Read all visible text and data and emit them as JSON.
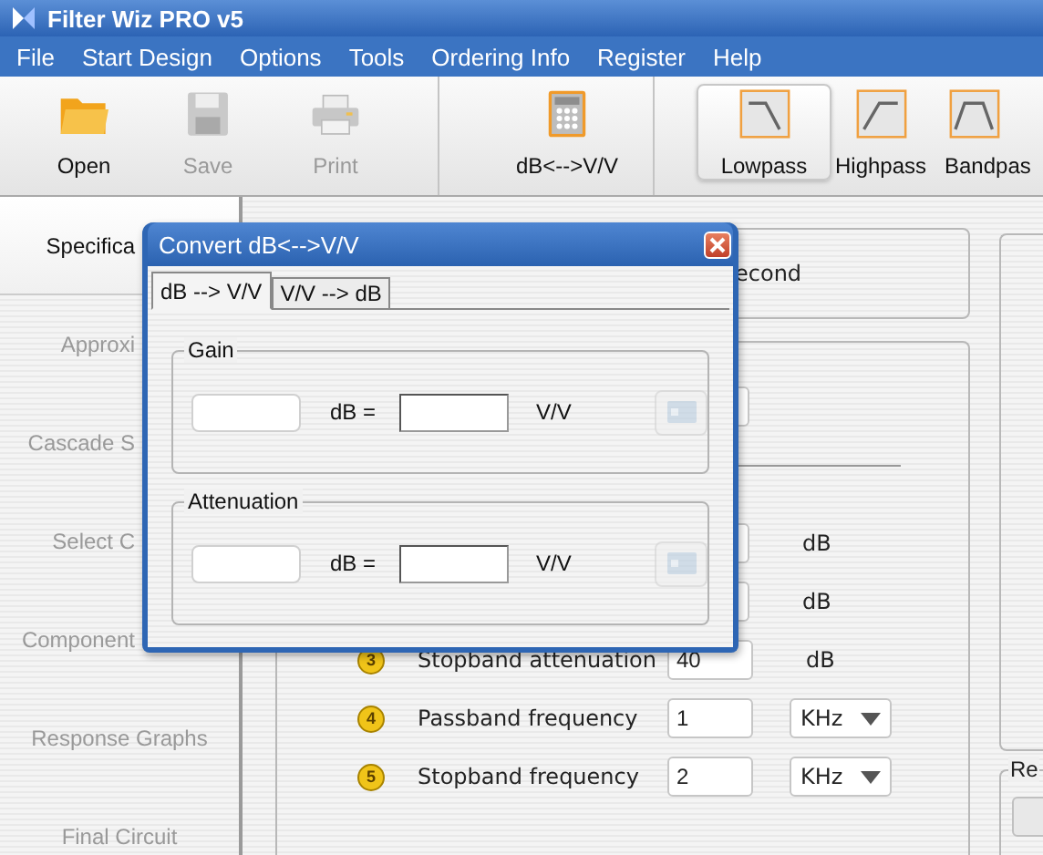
{
  "window": {
    "title": "Filter Wiz PRO v5"
  },
  "menu": [
    "File",
    "Start Design",
    "Options",
    "Tools",
    "Ordering Info",
    "Register",
    "Help"
  ],
  "toolbar": {
    "groups": [
      [
        {
          "label": "Open",
          "disabled": false
        },
        {
          "label": "Save",
          "disabled": true
        },
        {
          "label": "Print",
          "disabled": true
        }
      ],
      [
        {
          "label": "dB<-->V/V",
          "disabled": false
        }
      ],
      [
        {
          "label": "Lowpass",
          "selected": true
        },
        {
          "label": "Highpass",
          "selected": false
        },
        {
          "label": "Bandpas",
          "selected": false
        }
      ]
    ]
  },
  "sidebar": {
    "items": [
      {
        "label": "Specifica",
        "selected": true
      },
      {
        "label": "Approxi",
        "selected": false
      },
      {
        "label": "Cascade S",
        "selected": false
      },
      {
        "label": "Select C",
        "selected": false
      },
      {
        "label": "Component",
        "selected": false
      },
      {
        "label": "Response Graphs",
        "selected": false
      },
      {
        "label": "Final Circuit",
        "selected": false
      }
    ]
  },
  "main": {
    "top_group": {
      "text": "econd"
    },
    "rows": [
      {
        "kind": "field"
      },
      {
        "kind": "divider"
      },
      {
        "kind": "field",
        "unit": "dB"
      },
      {
        "kind": "field",
        "unit": "dB"
      },
      {
        "kind": "field",
        "number": "3",
        "label": "Stopband attenuation",
        "value": "40",
        "unit": "dB"
      },
      {
        "kind": "select",
        "number": "4",
        "label": "Passband frequency",
        "value": "1",
        "unit": "KHz"
      },
      {
        "kind": "select",
        "number": "5",
        "label": "Stopband frequency",
        "value": "2",
        "unit": "KHz"
      }
    ],
    "right_group": {
      "legend": "Re"
    }
  },
  "dialog": {
    "title": "Convert dB<-->V/V",
    "tabs": [
      {
        "label": "dB --> V/V",
        "selected": true
      },
      {
        "label": "V/V --> dB",
        "selected": false
      }
    ],
    "groups": [
      {
        "legend": "Gain",
        "equals": "dB =",
        "unit": "V/V",
        "button_disabled": true
      },
      {
        "legend": "Attenuation",
        "equals": "dB =",
        "unit": "V/V",
        "button_disabled": true
      }
    ]
  }
}
